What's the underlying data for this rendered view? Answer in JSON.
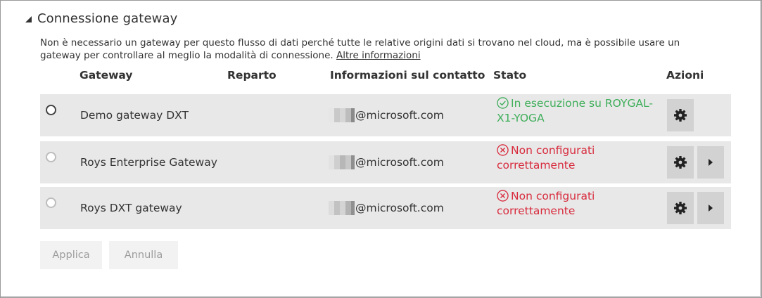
{
  "section": {
    "title": "Connessione gateway",
    "description": "Non è necessario un gateway per questo flusso di dati perché tutte le relative origini dati si trovano nel cloud, ma è possibile usare un gateway per controllare al meglio la modalità di connessione.",
    "more_info_link": "Altre informazioni"
  },
  "table": {
    "columns": {
      "gateway": "Gateway",
      "department": "Reparto",
      "contact": "Informazioni sul contatto",
      "status": "Stato",
      "actions": "Azioni"
    },
    "rows": [
      {
        "name": "Demo gateway DXT",
        "contact": "@microsoft.com",
        "status_line1": "In esecuzione su ROYGAL-",
        "status_line2": "X1-YOGA",
        "status_kind": "ok",
        "selected": true
      },
      {
        "name": "Roys Enterprise Gateway",
        "contact": "@microsoft.com",
        "status_line1": "Non configurati",
        "status_line2": "correttamente",
        "status_kind": "error",
        "selected": false
      },
      {
        "name": "Roys DXT gateway",
        "contact": "@microsoft.com",
        "status_line1": "Non configurati",
        "status_line2": "correttamente",
        "status_kind": "error",
        "selected": false
      }
    ]
  },
  "buttons": {
    "apply": "Applica",
    "cancel": "Annulla"
  },
  "colors": {
    "status_ok": "#3fae5a",
    "status_error": "#d82b3d",
    "row_background": "#e8e8e8",
    "action_button": "#d2d2d2"
  },
  "icons": [
    "collapse-triangle-icon",
    "radio-icon",
    "check-circle-icon",
    "error-circle-icon",
    "gear-icon",
    "play-arrow-icon"
  ]
}
